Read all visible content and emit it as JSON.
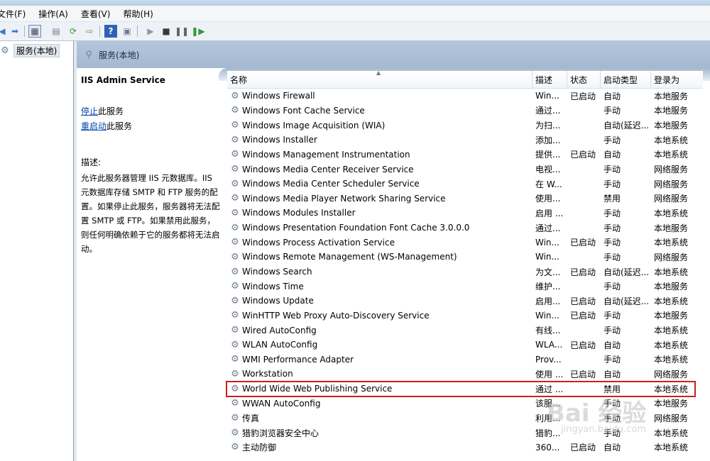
{
  "menubar": {
    "items": [
      "文件(F)",
      "操作(A)",
      "查看(V)",
      "帮助(H)"
    ]
  },
  "toolbar": {
    "buttons": [
      "back-arrow-icon",
      "forward-arrow-icon",
      "console-tree-icon",
      "properties-icon",
      "refresh-icon",
      "export-icon",
      "help-icon",
      "view-icon",
      "play-icon",
      "stop-icon",
      "pause-icon",
      "restart-icon"
    ]
  },
  "tree": {
    "root_label": "服务(本地)"
  },
  "pane_header": {
    "title": "服务(本地)"
  },
  "details": {
    "service_name": "IIS Admin Service",
    "stop_link": "停止",
    "stop_suffix": "此服务",
    "restart_link": "重启动",
    "restart_suffix": "此服务",
    "desc_label": "描述:",
    "description": "允许此服务器管理 IIS 元数据库。IIS 元数据库存储 SMTP 和 FTP 服务的配置。如果停止此服务，服务器将无法配置 SMTP 或 FTP。如果禁用此服务，则任何明确依赖于它的服务都将无法启动。"
  },
  "table": {
    "columns": [
      "名称",
      "描述",
      "状态",
      "启动类型",
      "登录为"
    ],
    "rows": [
      [
        "Windows Firewall",
        "Win...",
        "已启动",
        "自动",
        "本地服务"
      ],
      [
        "Windows Font Cache Service",
        "通过...",
        "",
        "手动",
        "本地服务"
      ],
      [
        "Windows Image Acquisition (WIA)",
        "为扫...",
        "",
        "自动(延迟...",
        "本地服务"
      ],
      [
        "Windows Installer",
        "添加...",
        "",
        "手动",
        "本地系统"
      ],
      [
        "Windows Management Instrumentation",
        "提供...",
        "已启动",
        "自动",
        "本地系统"
      ],
      [
        "Windows Media Center Receiver Service",
        "电视...",
        "",
        "手动",
        "网络服务"
      ],
      [
        "Windows Media Center Scheduler Service",
        "在 W...",
        "",
        "手动",
        "网络服务"
      ],
      [
        "Windows Media Player Network Sharing Service",
        "使用...",
        "",
        "禁用",
        "网络服务"
      ],
      [
        "Windows Modules Installer",
        "启用 ...",
        "",
        "手动",
        "本地系统"
      ],
      [
        "Windows Presentation Foundation Font Cache 3.0.0.0",
        "通过...",
        "",
        "手动",
        "本地服务"
      ],
      [
        "Windows Process Activation Service",
        "Win...",
        "已启动",
        "手动",
        "本地系统"
      ],
      [
        "Windows Remote Management (WS-Management)",
        "Win...",
        "",
        "手动",
        "网络服务"
      ],
      [
        "Windows Search",
        "为文...",
        "已启动",
        "自动(延迟...",
        "本地系统"
      ],
      [
        "Windows Time",
        "维护...",
        "",
        "手动",
        "本地服务"
      ],
      [
        "Windows Update",
        "启用...",
        "已启动",
        "自动(延迟...",
        "本地系统"
      ],
      [
        "WinHTTP Web Proxy Auto-Discovery Service",
        "Win...",
        "已启动",
        "手动",
        "本地服务"
      ],
      [
        "Wired AutoConfig",
        "有线...",
        "",
        "手动",
        "本地系统"
      ],
      [
        "WLAN AutoConfig",
        "WLA...",
        "已启动",
        "自动",
        "本地系统"
      ],
      [
        "WMI Performance Adapter",
        "Prov...",
        "",
        "手动",
        "本地系统"
      ],
      [
        "Workstation",
        "使用 ...",
        "已启动",
        "自动",
        "网络服务"
      ],
      [
        "World Wide Web Publishing Service",
        "通过 ...",
        "",
        "禁用",
        "本地系统"
      ],
      [
        "WWAN AutoConfig",
        "该服...",
        "",
        "手动",
        "本地服务"
      ],
      [
        "传真",
        "利用...",
        "",
        "手动",
        "网络服务"
      ],
      [
        "猎豹浏览器安全中心",
        "猎豹...",
        "",
        "手动",
        "本地系统"
      ],
      [
        "主动防御",
        "360...",
        "已启动",
        "自动",
        "本地系统"
      ]
    ],
    "highlighted_row": "World Wide Web Publishing Service"
  },
  "watermark": {
    "brand": "Bai 经验",
    "sub": "jingyan.baidu.com"
  }
}
